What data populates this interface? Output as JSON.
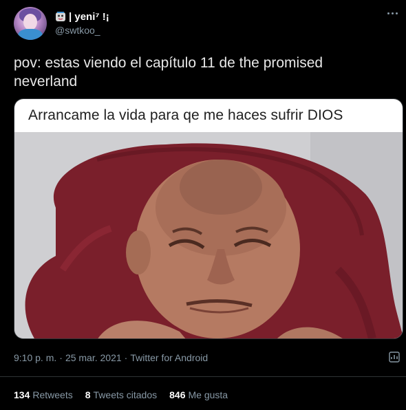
{
  "user": {
    "display_name": "| yeni⁷ !¡",
    "handle": "@swtkoo_",
    "badge_icon": "ghost-emoji-icon"
  },
  "tweet": {
    "text_line1": "pov: estas viendo el capítulo 11 de the promised",
    "text_line2": "neverland"
  },
  "media": {
    "caption": "Arrancame la vida para qe me haces sufrir DIOS",
    "image_subject": "man-crying-on-red-pillow-photo"
  },
  "meta": {
    "time": "9:10 p. m.",
    "separator1": "·",
    "date": "25 mar. 2021",
    "separator2": "·",
    "source": "Twitter for Android"
  },
  "stats": {
    "retweets_count": "134",
    "retweets_label": "Retweets",
    "quotes_count": "8",
    "quotes_label": "Tweets citados",
    "likes_count": "846",
    "likes_label": "Me gusta"
  },
  "colors": {
    "background": "#000000",
    "secondary_text": "#8899a6",
    "divider": "#2f3336",
    "pillow": "#7a1f2b"
  }
}
